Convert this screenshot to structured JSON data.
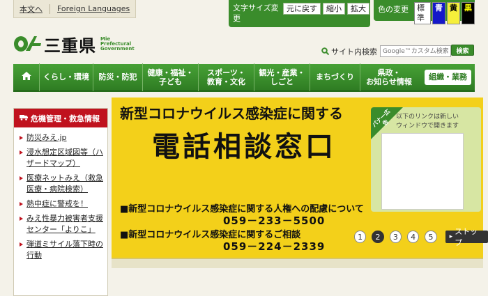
{
  "utility": {
    "body_link": "本文へ",
    "foreign_link": "Foreign Languages"
  },
  "font_size": {
    "label": "文字サイズ変更",
    "reset": "元に戻す",
    "smaller": "縮小",
    "larger": "拡大"
  },
  "color_change": {
    "label": "色の変更",
    "standard": "標準",
    "blue": "青",
    "yellow": "黄",
    "black": "黒"
  },
  "logo": {
    "kanji": "三重県",
    "eng1": "Mie",
    "eng2": "Prefectural",
    "eng3": "Government"
  },
  "search": {
    "label": "サイト内検索",
    "placeholder": "Google™カスタム検索",
    "button": "検索"
  },
  "nav": {
    "home_icon": "home-icon",
    "items": [
      "くらし・環境",
      "防災・防犯",
      "健康・福祉・\n子ども",
      "スポーツ・\n教育・文化",
      "観光・産業・\nしごと",
      "まちづくり",
      "県政・\nお知らせ情報",
      "組織・業務"
    ]
  },
  "emergency": {
    "title": "危機管理・救急情報",
    "items": [
      "防災みえ.jp",
      "浸水想定区域図等（ハザードマップ）",
      "医療ネットみえ（救急医療・病院検索）",
      "熱中症に警戒を！",
      "みえ性暴力被害者支援センター「よりこ」",
      "弾道ミサイル落下時の行動"
    ]
  },
  "banner": {
    "title1": "新型コロナウイルス感染症に関する",
    "title2": "電話相談窓口",
    "line1": "■新型コロナウイルス感染症に関する人権への配慮について",
    "phone1": "059－233－5500",
    "line2": "■新型コロナウイルス感染症に関するご相談",
    "phone2": "059－224－2339"
  },
  "ad": {
    "tag": "バナー広告",
    "note": "以下のリンクは新しい\nウィンドウで開きます"
  },
  "pager": {
    "pages": [
      "1",
      "2",
      "3",
      "4",
      "5"
    ],
    "active": "2",
    "stop": "ストップ"
  },
  "colors": {
    "green": "#3a8c2b",
    "red": "#c0121e",
    "yellow": "#f3d01a"
  }
}
